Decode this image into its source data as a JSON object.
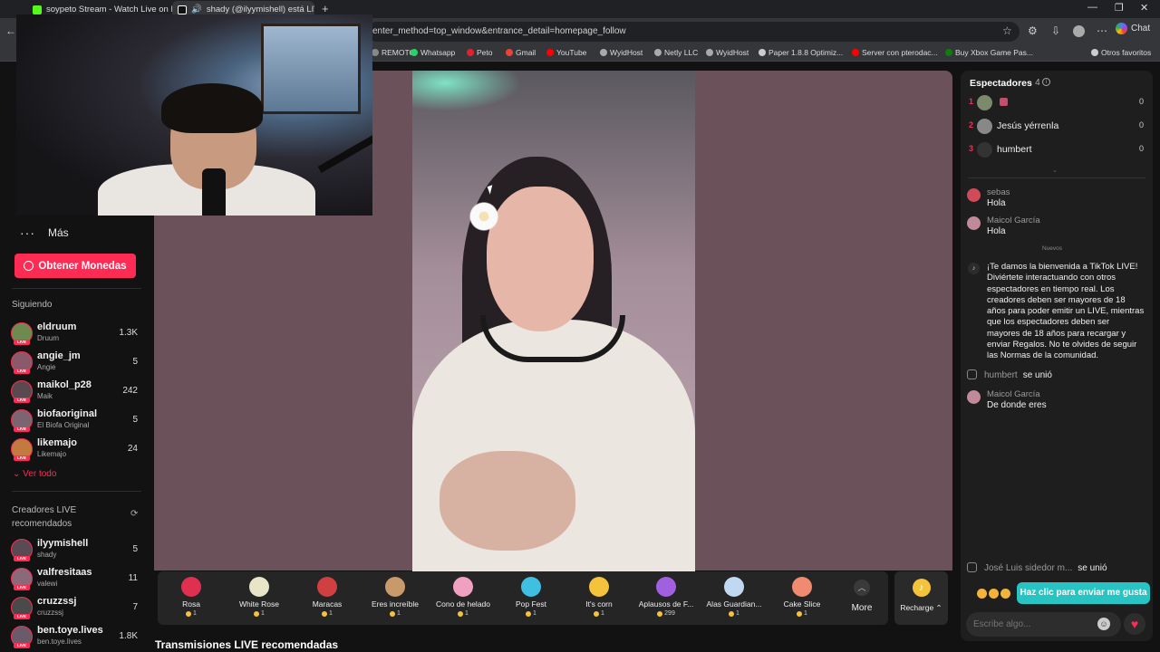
{
  "browser": {
    "tabs": [
      {
        "title": "soypeto Stream - Watch Live on K",
        "color": "#53fc18"
      },
      {
        "title": "shady (@ilyymishell) está LIVE",
        "color": "#ffffff"
      }
    ],
    "url": "enter_method=top_window&entrance_detail=homepage_follow",
    "chat_label": "Chat",
    "bookmarks": [
      {
        "label": "REMOTO",
        "color": "#888888"
      },
      {
        "label": "Whatsapp",
        "color": "#25d366"
      },
      {
        "label": "Peto",
        "color": "#e5202e"
      },
      {
        "label": "Gmail",
        "color": "#ea4335"
      },
      {
        "label": "YouTube",
        "color": "#ff0000"
      },
      {
        "label": "WyidHost",
        "color": "#aaaaaa"
      },
      {
        "label": "Netly LLC",
        "color": "#aaaaaa"
      },
      {
        "label": "WyidHost",
        "color": "#aaaaaa"
      },
      {
        "label": "Paper 1.8.8 Optimiz...",
        "color": "#cccccc"
      },
      {
        "label": "Server con pterodac...",
        "color": "#ff0000"
      },
      {
        "label": "Buy Xbox Game Pas...",
        "color": "#107c10"
      },
      {
        "label": "Otros favoritos",
        "color": "#cccccc"
      }
    ]
  },
  "sidebar": {
    "more_label": "Más",
    "coins_button": "Obtener Monedas",
    "following_title": "Siguiendo",
    "following": [
      {
        "name": "eldruum",
        "sub": "Druum",
        "count": "1.3K",
        "color": "#6d8a4f"
      },
      {
        "name": "angie_jm",
        "sub": "Angie",
        "count": "5",
        "color": "#8a5a6a"
      },
      {
        "name": "maikol_p28",
        "sub": "Maik",
        "count": "242",
        "color": "#5a4a4f"
      },
      {
        "name": "biofaoriginal",
        "sub": "El Biofa Original",
        "count": "5",
        "color": "#7a6570"
      },
      {
        "name": "likemajo",
        "sub": "Likemajo",
        "count": "24",
        "color": "#c27a3e"
      }
    ],
    "see_all": "Ver todo",
    "recommended_title_1": "Creadores LIVE",
    "recommended_title_2": "recomendados",
    "recommended": [
      {
        "name": "ilyymishell",
        "sub": "shady",
        "count": "5",
        "color": "#5a4a55"
      },
      {
        "name": "valfresitaas",
        "sub": "valewi",
        "count": "11",
        "color": "#8a6a7a"
      },
      {
        "name": "cruzzssj",
        "sub": "cruzzssj",
        "count": "7",
        "color": "#4a4a4a"
      },
      {
        "name": "ben.toye.lives",
        "sub": "ben.toye.lives",
        "count": "1.8K",
        "color": "#6a5a6a"
      }
    ],
    "live_badge": "LIVE"
  },
  "gifts": [
    {
      "name": "Rosa",
      "price": "1",
      "color": "#e03050"
    },
    {
      "name": "White Rose",
      "price": "1",
      "color": "#e8e4c8"
    },
    {
      "name": "Maracas",
      "price": "1",
      "color": "#d04040"
    },
    {
      "name": "Eres increíble",
      "price": "1",
      "color": "#c89a6a"
    },
    {
      "name": "Cono de helado",
      "price": "1",
      "color": "#f0a0c0"
    },
    {
      "name": "Pop Fest",
      "price": "1",
      "color": "#40c0e0"
    },
    {
      "name": "It's corn",
      "price": "1",
      "color": "#f5c33b"
    },
    {
      "name": "Aplausos de F...",
      "price": "299",
      "color": "#a060e0"
    },
    {
      "name": "Alas Guardian...",
      "price": "1",
      "color": "#c0d8f0"
    },
    {
      "name": "Cake Slice",
      "price": "1",
      "color": "#f08a70"
    }
  ],
  "more_label": "More",
  "recharge_label": "Recharge",
  "recommended_streams": "Transmisiones LIVE recomendadas",
  "viewers": {
    "title": "Espectadores",
    "count": "· 4",
    "ranking": [
      {
        "rank": "1",
        "name": "",
        "score": "0",
        "color": "#7a8a6a"
      },
      {
        "rank": "2",
        "name": "Jesús yérrenla",
        "score": "0",
        "color": "#888888"
      },
      {
        "rank": "3",
        "name": "humbert",
        "score": "0",
        "color": "#333333"
      }
    ]
  },
  "chat": {
    "messages_before": [
      {
        "user": "sebas",
        "text": "Hola",
        "color": "#d04a5a"
      },
      {
        "user": "Maicol García",
        "text": "Hola",
        "color": "#c08a9a"
      }
    ],
    "new_label": "Nuevos",
    "welcome": "¡Te damos la bienvenida a TikTok LIVE! Diviértete interactuando con otros espectadores en tiempo real. Los creadores deben ser mayores de 18 años para poder emitir un LIVE, mientras que los espectadores deben ser mayores de 18 años para recargar y enviar Regalos. No te olvides de seguir las Normas de la comunidad.",
    "join1_user": "humbert",
    "join1_text": "se unió",
    "msg_after": {
      "user": "Maicol García",
      "text": "De donde eres",
      "color": "#c08a9a"
    },
    "join2_user": "José Luis sidedor m...",
    "join2_text": "se unió",
    "like_tip": "Haz clic para enviar me gusta",
    "input_placeholder": "Escribe algo..."
  }
}
